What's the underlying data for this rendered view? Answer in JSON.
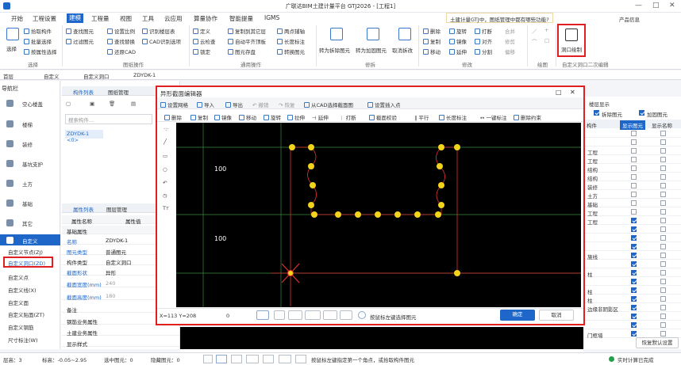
{
  "title_bar": {
    "title": "广联达BIM土建计量平台 GTJ2026 - [工程1]",
    "controls": [
      "—",
      "□",
      "✕"
    ]
  },
  "menu": [
    "开始",
    "工程设置",
    "建模",
    "工程量",
    "视图",
    "工具",
    "云应用",
    "算量协作",
    "智能提量",
    "IGMS"
  ],
  "menu_active": "建模",
  "notice": {
    "text": "土建计量GTJ中，图纸管理中都有哪些功能?",
    "product": "产品信息"
  },
  "ribbon": {
    "select": {
      "big": "选择",
      "items": [
        "拾取构件",
        "批量选择",
        "按属性选择"
      ],
      "group": "选择"
    },
    "drawing": {
      "items": [
        "查找图元",
        "过滤图元",
        "设置比例",
        "查找替换",
        "还原CAD",
        "识别楼层表",
        "CAD识别选项"
      ],
      "group": "图纸操作"
    },
    "general": {
      "items": [
        "定义",
        "云检查",
        "锁定",
        "复制到其它层",
        "自动平齐顶板",
        "图元存盘",
        "两点辅轴",
        "长度标注",
        "转换图元"
      ],
      "group": "通用操作"
    },
    "revise": {
      "items": [
        "转为拆除图元",
        "转为加固图元",
        "取消拆改"
      ],
      "group": "修拆"
    },
    "modify": {
      "items": [
        "删除",
        "复制",
        "移动",
        "旋转",
        "镜像",
        "延伸",
        "打断",
        "对齐",
        "合并",
        "修剪",
        "偏移",
        "分割"
      ],
      "group": "修改"
    },
    "draw": {
      "group": "绘图"
    },
    "custom": {
      "item": "洞口绘制",
      "group": "自定义洞口二次编辑"
    }
  },
  "filter_bar": {
    "floor": "首层",
    "type1": "自定义",
    "type2": "自定义洞口",
    "item": "ZDYDK-1"
  },
  "nav": {
    "header": "导航栏",
    "items": [
      "空心楼盖",
      "楼梯",
      "装修",
      "基坑支护",
      "土方",
      "基础",
      "其它",
      "自定义"
    ],
    "selected": "自定义",
    "sub": [
      "自定义节点(ZJ)",
      "自定义洞口(ZD)",
      "自定义点",
      "自定义线(X)",
      "自定义面",
      "自定义贴面(ZT)",
      "自定义钢筋",
      "尺寸标注(W)"
    ],
    "sub_selected": "自定义洞口(ZD)"
  },
  "component_panel": {
    "tabs": [
      "构件列表",
      "图纸管理"
    ],
    "search_placeholder": "搜索构件...",
    "item": "ZDYDK-1 <0>"
  },
  "property_panel": {
    "tabs": [
      "属性列表",
      "图层管理"
    ],
    "header": [
      "属性名称",
      "属性值"
    ],
    "group": "基础属性",
    "rows": [
      {
        "k": "名称",
        "v": "ZDYDK-1"
      },
      {
        "k": "图元类型",
        "v": "普通图元"
      },
      {
        "k": "构件类型",
        "v": "自定义洞口"
      },
      {
        "k": "截面形状",
        "v": "异形"
      },
      {
        "k": "截面宽度(mm)",
        "v": "240"
      },
      {
        "k": "截面高度(mm)",
        "v": "180"
      },
      {
        "k": "备注",
        "v": ""
      }
    ],
    "more": [
      "钢筋业务属性",
      "土建业务属性",
      "显示样式"
    ]
  },
  "editor": {
    "title": "异形截面编辑器",
    "toolbar1": [
      "设置网格",
      "导入",
      "导出",
      "撤销",
      "恢复",
      "从CAD选择截面图",
      "设置插入点"
    ],
    "toolbar2": [
      "删除",
      "复制",
      "镜像",
      "移动",
      "旋转",
      "拉伸",
      "延伸",
      "打断",
      "截面校验",
      "平行",
      "长度标注",
      "一键标注",
      "删除约束"
    ],
    "dims": [
      "100",
      "100"
    ],
    "coords": "X=113 Y=208",
    "zero": "0",
    "hint": "按鼠标左键选择图元",
    "ok": "确定",
    "cancel": "取消"
  },
  "right_grid": {
    "top_tab": "楼层显示",
    "checks": [
      "拆除图元",
      "加固图元"
    ],
    "headers": [
      "构件",
      "显示图元",
      "显示名称"
    ],
    "rows": [
      "",
      "",
      "工程",
      "工程",
      "结构",
      "结构",
      "装修",
      "土方",
      "基础",
      "工程",
      "工程",
      "",
      "",
      "",
      "施线",
      "",
      "柱",
      "",
      "柱",
      "柱",
      "边缘非阴影区",
      "",
      "",
      "门框墙",
      "砌体墙"
    ],
    "restore": "恢复默认设置"
  },
  "status_bar": {
    "layer": "层高：3",
    "elev": "标高：-0.05~2.95",
    "selected": "选中图元：0",
    "hidden": "隐藏图元：0",
    "hint": "按鼠标左键指定第一个角点，或拾取构件图元",
    "realtime": "实时计算已完成"
  }
}
